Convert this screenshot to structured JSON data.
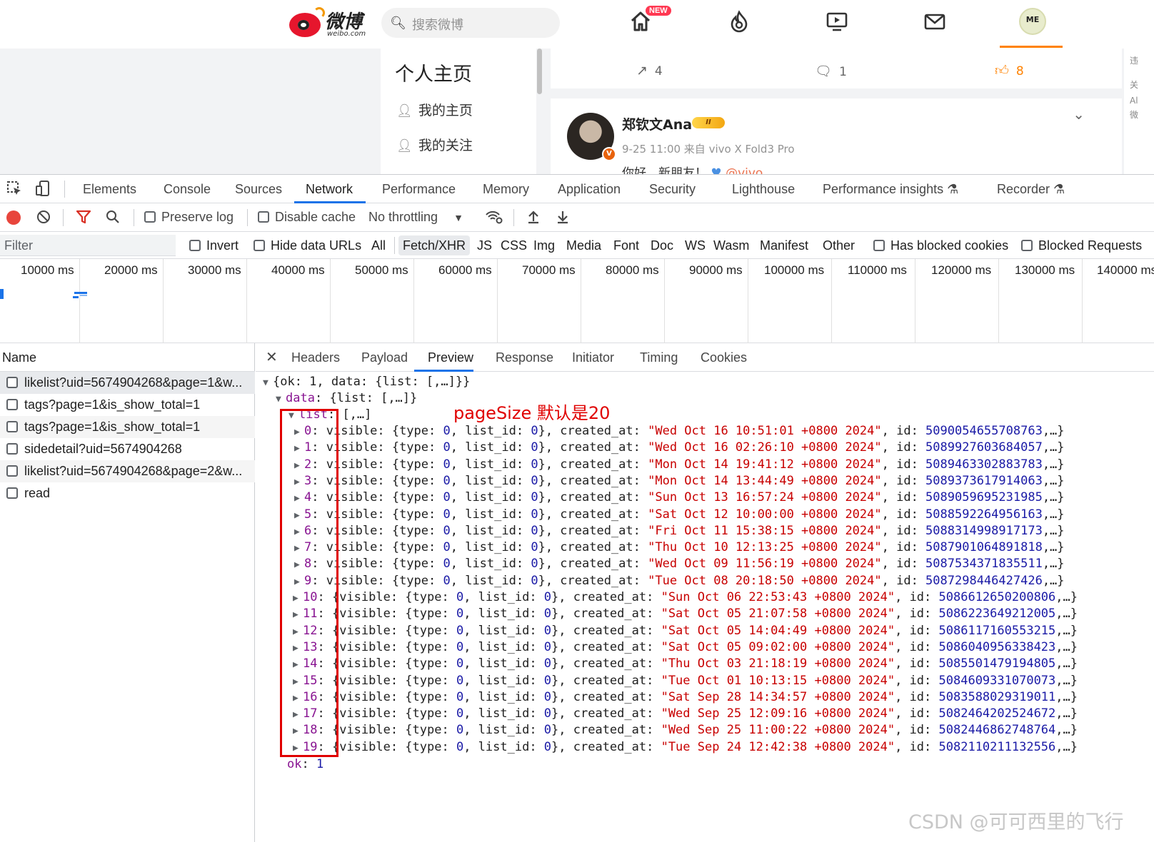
{
  "weibo": {
    "logo_text": "微博",
    "logo_sub": "weibo.com",
    "search_placeholder": "搜索微博",
    "new_badge": "NEW",
    "me_label": "ME",
    "page_title": "个人主页",
    "nav_items": [
      "我的主页",
      "我的关注"
    ],
    "actions": {
      "share": "4",
      "comment": "1",
      "like": "8"
    },
    "post": {
      "author": "郑钦文Ana",
      "vip": "II",
      "meta": "9-25 11:00 来自 vivo X Fold3 Pro",
      "text": "你好，新朋友！",
      "mention": "@vivo"
    },
    "rightcol": [
      "违",
      "关",
      "Al",
      "微"
    ]
  },
  "devtools": {
    "tabs": [
      "Elements",
      "Console",
      "Sources",
      "Network",
      "Performance",
      "Memory",
      "Application",
      "Security",
      "Lighthouse",
      "Performance insights",
      "Recorder"
    ],
    "active_tab": "Network",
    "toolbar": {
      "preserve_log": "Preserve log",
      "disable_cache": "Disable cache",
      "throttling": "No throttling"
    },
    "filter": {
      "placeholder": "Filter",
      "invert": "Invert",
      "hide_data_urls": "Hide data URLs",
      "types": [
        "All",
        "Fetch/XHR",
        "JS",
        "CSS",
        "Img",
        "Media",
        "Font",
        "Doc",
        "WS",
        "Wasm",
        "Manifest",
        "Other"
      ],
      "selected_type": "Fetch/XHR",
      "has_blocked_cookies": "Has blocked cookies",
      "blocked_requests": "Blocked Requests"
    },
    "timeline_ticks": [
      "10000 ms",
      "20000 ms",
      "30000 ms",
      "40000 ms",
      "50000 ms",
      "60000 ms",
      "70000 ms",
      "80000 ms",
      "90000 ms",
      "100000 ms",
      "110000 ms",
      "120000 ms",
      "130000 ms",
      "140000 ms"
    ],
    "requests_header": "Name",
    "requests": [
      "likelist?uid=5674904268&page=1&w...",
      "tags?page=1&is_show_total=1",
      "tags?page=1&is_show_total=1",
      "sidedetail?uid=5674904268",
      "likelist?uid=5674904268&page=2&w...",
      "read"
    ],
    "detail_tabs": [
      "Headers",
      "Payload",
      "Preview",
      "Response",
      "Initiator",
      "Timing",
      "Cookies"
    ],
    "active_detail_tab": "Preview",
    "preview": {
      "root": "{ok: 1, data: {list: [,…]}}",
      "data_line": "{list: [,…]}",
      "list_line": "[,…]",
      "annotation": "pageSize 默认是20",
      "items": [
        {
          "idx": "0",
          "created_at": "\"Wed Oct 16 10:51:01 +0800 2024\"",
          "id": "5090054655708763"
        },
        {
          "idx": "1",
          "created_at": "\"Wed Oct 16 02:26:10 +0800 2024\"",
          "id": "5089927603684057"
        },
        {
          "idx": "2",
          "created_at": "\"Mon Oct 14 19:41:12 +0800 2024\"",
          "id": "5089463302883783"
        },
        {
          "idx": "3",
          "created_at": "\"Mon Oct 14 13:44:49 +0800 2024\"",
          "id": "5089373617914063"
        },
        {
          "idx": "4",
          "created_at": "\"Sun Oct 13 16:57:24 +0800 2024\"",
          "id": "5089059695231985"
        },
        {
          "idx": "5",
          "created_at": "\"Sat Oct 12 10:00:00 +0800 2024\"",
          "id": "5088592264956163"
        },
        {
          "idx": "6",
          "created_at": "\"Fri Oct 11 15:38:15 +0800 2024\"",
          "id": "5088314998917173"
        },
        {
          "idx": "7",
          "created_at": "\"Thu Oct 10 12:13:25 +0800 2024\"",
          "id": "5087901064891818"
        },
        {
          "idx": "8",
          "created_at": "\"Wed Oct 09 11:56:19 +0800 2024\"",
          "id": "5087534371835511"
        },
        {
          "idx": "9",
          "created_at": "\"Tue Oct 08 20:18:50 +0800 2024\"",
          "id": "5087298446427426"
        },
        {
          "idx": "10",
          "created_at": "\"Sun Oct 06 22:53:43 +0800 2024\"",
          "id": "5086612650200806"
        },
        {
          "idx": "11",
          "created_at": "\"Sat Oct 05 21:07:58 +0800 2024\"",
          "id": "5086223649212005"
        },
        {
          "idx": "12",
          "created_at": "\"Sat Oct 05 14:04:49 +0800 2024\"",
          "id": "5086117160553215"
        },
        {
          "idx": "13",
          "created_at": "\"Sat Oct 05 09:02:00 +0800 2024\"",
          "id": "5086040956338423"
        },
        {
          "idx": "14",
          "created_at": "\"Thu Oct 03 21:18:19 +0800 2024\"",
          "id": "5085501479194805"
        },
        {
          "idx": "15",
          "created_at": "\"Tue Oct 01 10:13:15 +0800 2024\"",
          "id": "5084609331070073"
        },
        {
          "idx": "16",
          "created_at": "\"Sat Sep 28 14:34:57 +0800 2024\"",
          "id": "5083588029319011"
        },
        {
          "idx": "17",
          "created_at": "\"Wed Sep 25 12:09:16 +0800 2024\"",
          "id": "5082464202524672"
        },
        {
          "idx": "18",
          "created_at": "\"Wed Sep 25 11:00:22 +0800 2024\"",
          "id": "5082446862748764"
        },
        {
          "idx": "19",
          "created_at": "\"Tue Sep 24 12:42:38 +0800 2024\"",
          "id": "5082110211132556"
        }
      ],
      "ok_value": "1"
    }
  },
  "watermark": "CSDN @可可西里的飞行",
  "colors": {
    "weibo_red": "#e6162d",
    "weibo_orange": "#ff8200",
    "devtools_blue": "#1a73e8",
    "annotation_red": "#e00000"
  }
}
